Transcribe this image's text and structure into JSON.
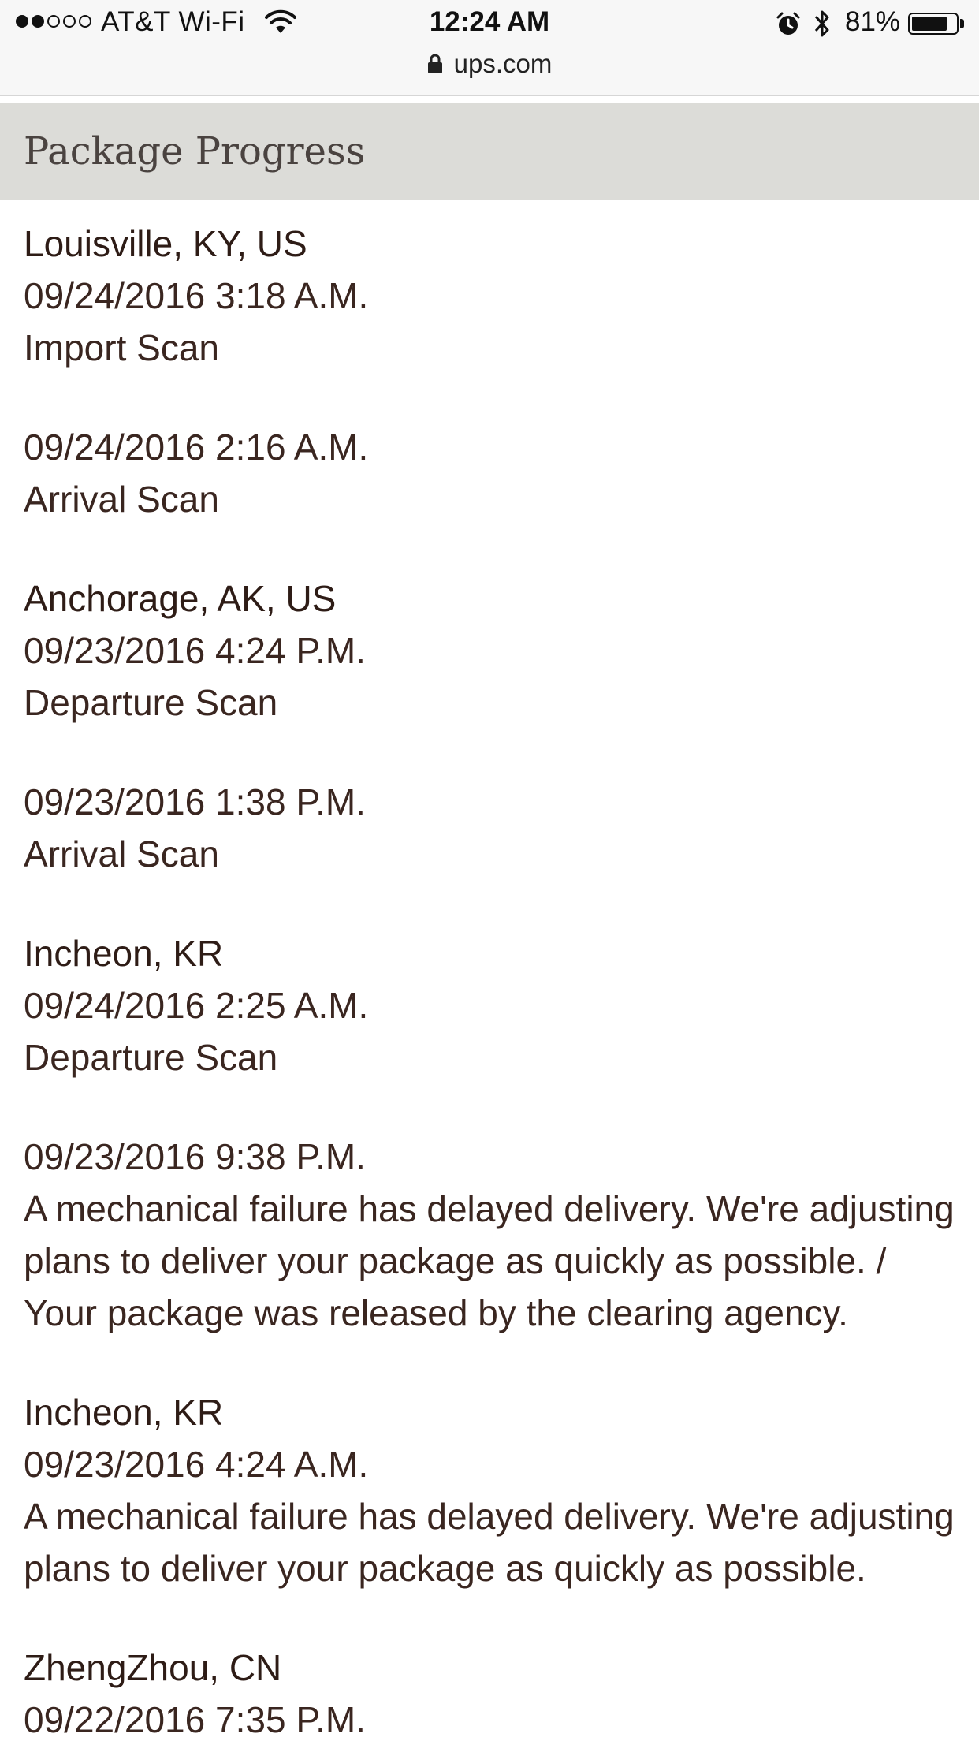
{
  "status_bar": {
    "signal_dots_filled": 2,
    "signal_dots_total": 5,
    "carrier": "AT&T Wi-Fi",
    "time": "12:24 AM",
    "battery_percent": "81%",
    "battery_level": 0.81
  },
  "url_bar": {
    "url": "ups.com"
  },
  "section": {
    "title": "Package Progress"
  },
  "events": [
    {
      "location": "Louisville, KY, US",
      "datetime": "09/24/2016 3:18 A.M.",
      "activity": "Import Scan"
    },
    {
      "location": "",
      "datetime": "09/24/2016 2:16 A.M.",
      "activity": "Arrival Scan"
    },
    {
      "location": "Anchorage, AK, US",
      "datetime": "09/23/2016 4:24 P.M.",
      "activity": "Departure Scan"
    },
    {
      "location": "",
      "datetime": "09/23/2016 1:38 P.M.",
      "activity": "Arrival Scan"
    },
    {
      "location": "Incheon, KR",
      "datetime": "09/24/2016 2:25 A.M.",
      "activity": "Departure Scan"
    },
    {
      "location": "",
      "datetime": "09/23/2016 9:38 P.M.",
      "activity": "A mechanical failure has delayed delivery. We're adjusting plans to deliver your package as quickly as possible. / Your package was released by the clearing agency."
    },
    {
      "location": "Incheon, KR",
      "datetime": "09/23/2016 4:24 A.M.",
      "activity": "A mechanical failure has delayed delivery. We're adjusting plans to deliver your package as quickly as possible."
    },
    {
      "location": "ZhengZhou, CN",
      "datetime": "09/22/2016 7:35 P.M.",
      "activity": ""
    }
  ]
}
